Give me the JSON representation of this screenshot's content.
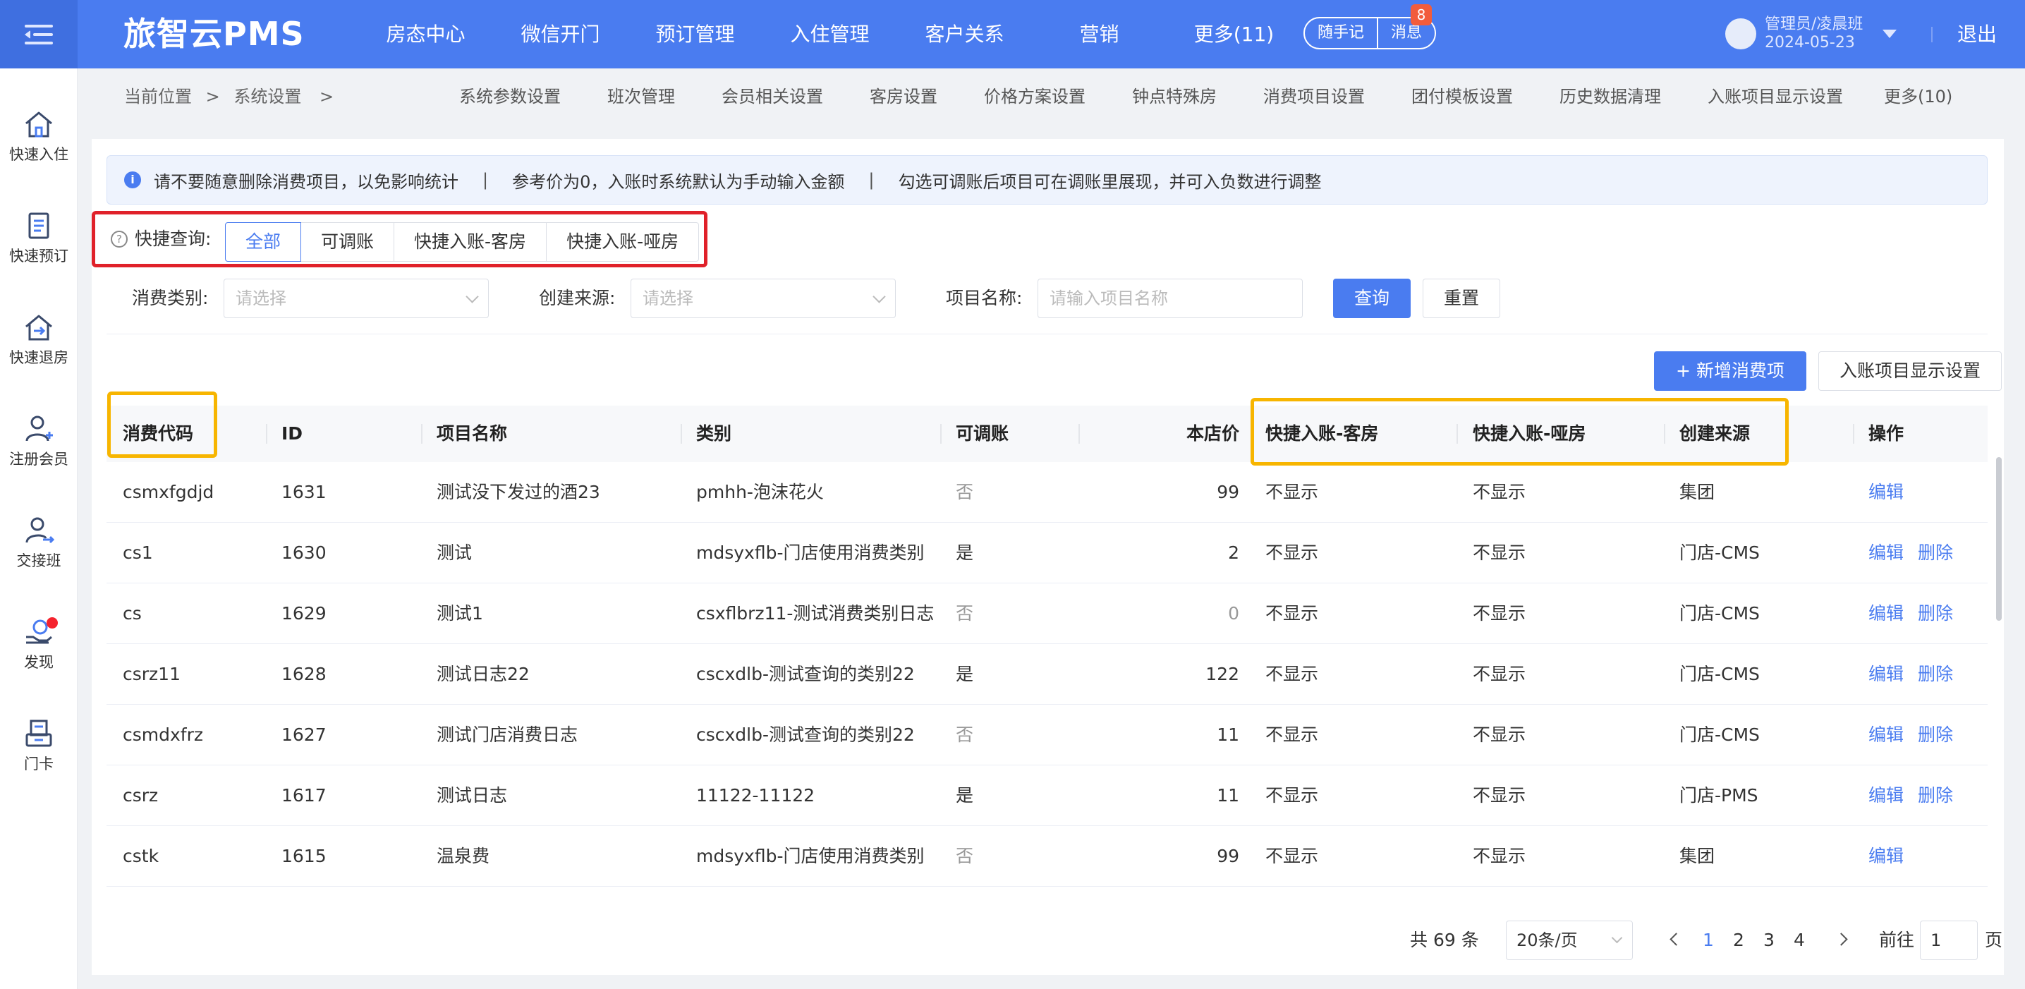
{
  "header": {
    "brand": "旅智云PMS",
    "nav": [
      "房态中心",
      "微信开门",
      "预订管理",
      "入住管理",
      "客户关系",
      "营销",
      "更多(11)"
    ],
    "notes_label": "随手记",
    "messages_label": "消息",
    "messages_badge": "8",
    "user_name": "管理员/凌晨班",
    "user_date": "2024-05-23",
    "logout_label": "退出",
    "brand_color": "#4a7cf0"
  },
  "sidebar": {
    "items": [
      {
        "label": "快速入住",
        "icon": "home-icon"
      },
      {
        "label": "快速预订",
        "icon": "clipboard-icon"
      },
      {
        "label": "快速退房",
        "icon": "checkout-house-icon"
      },
      {
        "label": "注册会员",
        "icon": "add-user-icon"
      },
      {
        "label": "交接班",
        "icon": "shift-user-icon"
      },
      {
        "label": "发现",
        "icon": "discover-hand-coin-icon"
      },
      {
        "label": "门卡",
        "icon": "card-printer-icon"
      }
    ]
  },
  "breadcrumb": {
    "prefix": "当前位置",
    "current": "系统设置"
  },
  "subnav": [
    "系统参数设置",
    "班次管理",
    "会员相关设置",
    "客房设置",
    "价格方案设置",
    "钟点特殊房",
    "消费项目设置",
    "团付模板设置",
    "历史数据清理",
    "入账项目显示设置",
    "更多(10)"
  ],
  "notice": {
    "items": [
      "请不要随意删除消费项目，以免影响统计",
      "参考价为0，入账时系统默认为手动输入金额",
      "勾选可调账后项目可在调账里展现，并可入负数进行调整"
    ],
    "separator": "|"
  },
  "quick_query": {
    "label": "快捷查询:",
    "options": [
      "全部",
      "可调账",
      "快捷入账-客房",
      "快捷入账-哑房"
    ],
    "selected": "全部"
  },
  "filters": {
    "category_label": "消费类别:",
    "category_placeholder": "请选择",
    "source_label": "创建来源:",
    "source_placeholder": "请选择",
    "name_label": "项目名称:",
    "name_placeholder": "请输入项目名称",
    "query_label": "查询",
    "reset_label": "重置"
  },
  "actions": {
    "add_label": "+ 新增消费项",
    "display_settings_label": "入账项目显示设置"
  },
  "table": {
    "columns": [
      "消费代码",
      "ID",
      "项目名称",
      "类别",
      "可调账",
      "本店价",
      "快捷入账-客房",
      "快捷入账-哑房",
      "创建来源",
      "操作"
    ],
    "edit_label": "编辑",
    "delete_label": "删除",
    "rows": [
      {
        "code": "csmxfgdjd",
        "id": "1631",
        "name": "测试没下发过的酒23",
        "category": "pmhh-泡沫花火",
        "adjustable": "否",
        "price": "99",
        "quick_room": "不显示",
        "quick_dummy": "不显示",
        "source": "集团",
        "can_delete": false
      },
      {
        "code": "cs1",
        "id": "1630",
        "name": "测试",
        "category": "mdsyxflb-门店使用消费类别",
        "adjustable": "是",
        "price": "2",
        "quick_room": "不显示",
        "quick_dummy": "不显示",
        "source": "门店-CMS",
        "can_delete": true
      },
      {
        "code": "cs",
        "id": "1629",
        "name": "测试1",
        "category": "csxflbrz11-测试消费类别日志",
        "adjustable": "否",
        "price": "0",
        "quick_room": "不显示",
        "quick_dummy": "不显示",
        "source": "门店-CMS",
        "can_delete": true
      },
      {
        "code": "csrz11",
        "id": "1628",
        "name": "测试日志22",
        "category": "cscxdlb-测试查询的类别22",
        "adjustable": "是",
        "price": "122",
        "quick_room": "不显示",
        "quick_dummy": "不显示",
        "source": "门店-CMS",
        "can_delete": true
      },
      {
        "code": "csmdxfrz",
        "id": "1627",
        "name": "测试门店消费日志",
        "category": "cscxdlb-测试查询的类别22",
        "adjustable": "否",
        "price": "11",
        "quick_room": "不显示",
        "quick_dummy": "不显示",
        "source": "门店-CMS",
        "can_delete": true
      },
      {
        "code": "csrz",
        "id": "1617",
        "name": "测试日志",
        "category": "11122-11122",
        "adjustable": "是",
        "price": "11",
        "quick_room": "不显示",
        "quick_dummy": "不显示",
        "source": "门店-PMS",
        "can_delete": true
      },
      {
        "code": "cstk",
        "id": "1615",
        "name": "温泉费",
        "category": "mdsyxflb-门店使用消费类别",
        "adjustable": "否",
        "price": "99",
        "quick_room": "不显示",
        "quick_dummy": "不显示",
        "source": "集团",
        "can_delete": false
      }
    ]
  },
  "pagination": {
    "total_label": "共 69 条",
    "page_size": "20条/页",
    "pages": [
      "1",
      "2",
      "3",
      "4"
    ],
    "current_page": "1",
    "goto_prefix": "前往",
    "goto_value": "1",
    "goto_suffix": "页"
  },
  "annotations": {
    "red_box_color": "#e0212a",
    "orange_box_color": "#f7b500"
  }
}
